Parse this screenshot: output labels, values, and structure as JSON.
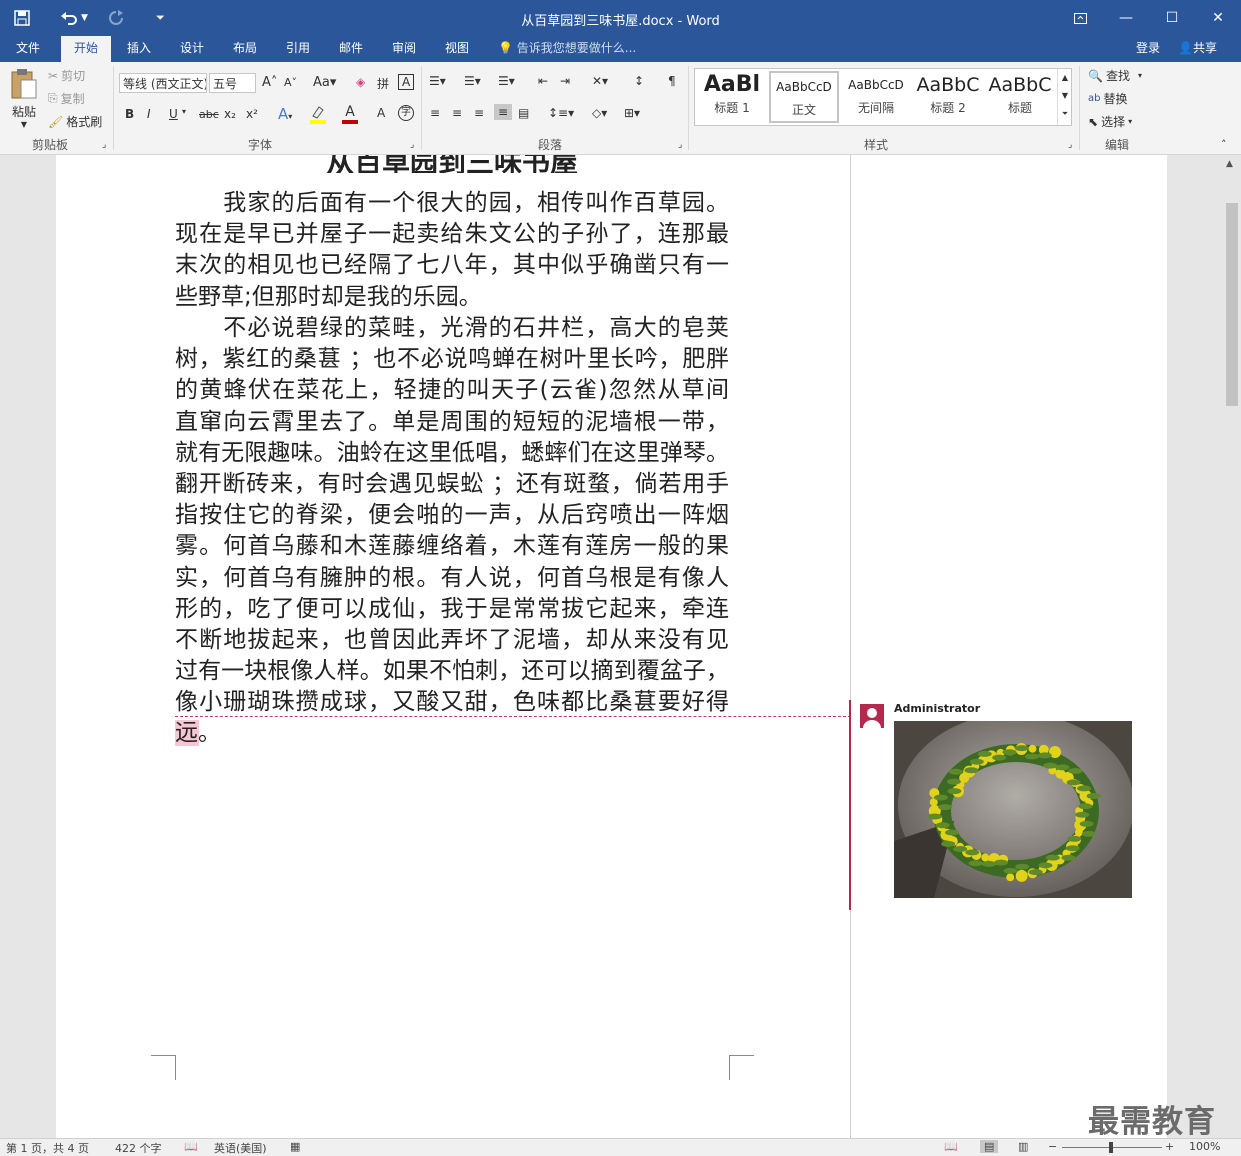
{
  "window": {
    "title": "从百草园到三味书屋.docx - Word",
    "quick_access": {
      "save_icon": "save-icon",
      "undo_icon": "undo-icon",
      "redo_icon": "redo-icon",
      "customize_icon": "customize-icon"
    },
    "controls": {
      "restore_ribbon": "ribbon-display-icon",
      "minimize": "—",
      "maximize": "☐",
      "close": "✕"
    }
  },
  "tabs": [
    {
      "label": "文件"
    },
    {
      "label": "开始"
    },
    {
      "label": "插入"
    },
    {
      "label": "设计"
    },
    {
      "label": "布局"
    },
    {
      "label": "引用"
    },
    {
      "label": "邮件"
    },
    {
      "label": "审阅"
    },
    {
      "label": "视图"
    }
  ],
  "active_tab": "开始",
  "tell_me": "告诉我您想要做什么...",
  "account": {
    "login": "登录",
    "share": "共享"
  },
  "ribbon": {
    "clipboard": {
      "paste": "粘贴",
      "cut": "剪切",
      "copy": "复制",
      "format_painter": "格式刷",
      "label": "剪贴板"
    },
    "font": {
      "font_name": "等线 (西文正文)",
      "font_size": "五号",
      "label": "字体",
      "bold": "B",
      "italic": "I",
      "underline": "U",
      "strike": "abc",
      "subscript": "x₂",
      "superscript": "x²",
      "grow": "A",
      "shrink": "A",
      "case": "Aa",
      "text_effect": "A",
      "font_color": "A"
    },
    "paragraph": {
      "label": "段落"
    },
    "styles": {
      "label": "样式",
      "items": [
        {
          "preview": "AaBl",
          "name": "标题 1"
        },
        {
          "preview": "AaBbCcD",
          "name": "正文"
        },
        {
          "preview": "AaBbCcD",
          "name": "无间隔"
        },
        {
          "preview": "AaBbC",
          "name": "标题 2"
        },
        {
          "preview": "AaBbC",
          "name": "标题"
        }
      ]
    },
    "editing": {
      "find": "查找",
      "replace": "替换",
      "select": "选择",
      "label": "编辑"
    }
  },
  "document": {
    "title": "从百草园到三味书屋",
    "paragraph1": [
      "　　我家的后面有一个很大的园，相传叫作百草园。",
      "现在是早已并屋子一起卖给朱文公的子孙了，连那最",
      "末次的相见也已经隔了七八年，其中似乎确凿只有一",
      "些野草;但那时却是我的乐园。"
    ],
    "paragraph2": [
      "　　不必说碧绿的菜畦，光滑的石井栏，高大的皂荚",
      "树，紫红的桑葚 ；也不必说鸣蝉在树叶里长吟，肥胖",
      "的黄蜂伏在菜花上，轻捷的叫天子(云雀)忽然从草间",
      "直窜向云霄里去了。单是周围的短短的泥墙根一带，",
      "就有无限趣味。油蛉在这里低唱，蟋蟀们在这里弹琴。",
      "翻开断砖来，有时会遇见蜈蚣 ；还有斑蝥，倘若用手",
      "指按住它的脊梁，便会啪的一声，从后窍喷出一阵烟",
      "雾。何首乌藤和木莲藤缠络着，木莲有莲房一般的果",
      "实，何首乌有臃肿的根。有人说，何首乌根是有像人",
      "形的，吃了便可以成仙，我于是常常拔它起来，牵连",
      "不断地拔起来，也曾因此弄坏了泥墙，却从来没有见",
      "过有一块根像人样。如果不怕刺，还可以摘到覆盆子，",
      "像小珊瑚珠攒成球，又酸又甜，色味都比桑葚要好得",
      "远。"
    ]
  },
  "comment": {
    "author": "Administrator",
    "image": "flower-wreath-photo"
  },
  "status": {
    "page": "第 1 页，共 4 页",
    "words": "422 个字",
    "language": "英语(美国)",
    "zoom": "100%"
  },
  "watermark": "最需教育",
  "colors": {
    "accent": "#2b579a",
    "comment": "#b5294e",
    "highlight": "#f6c6d4"
  }
}
